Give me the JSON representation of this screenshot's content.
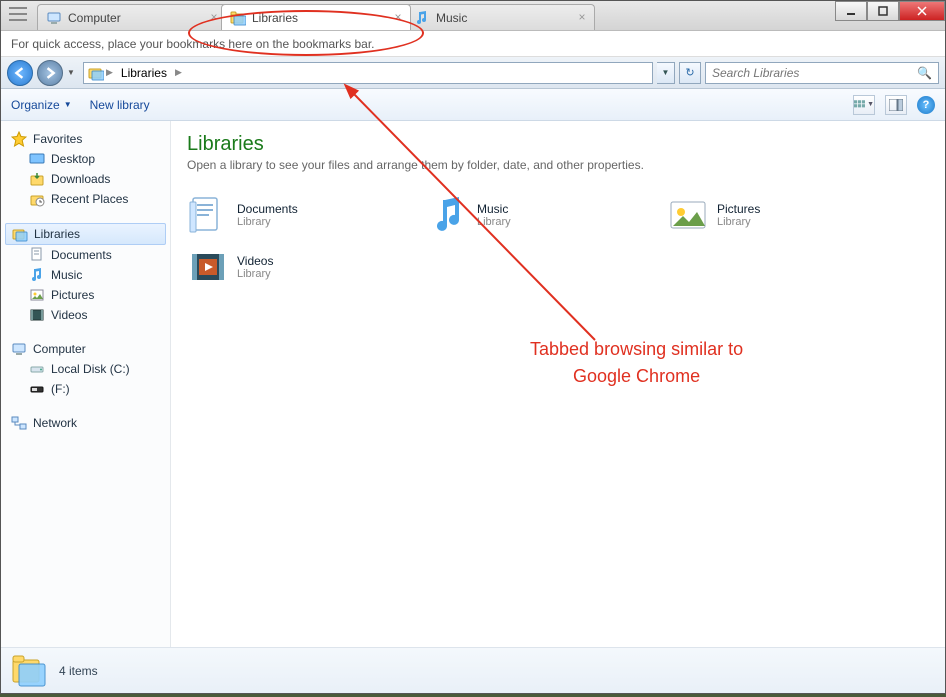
{
  "tabs": [
    {
      "label": "Computer",
      "active": false
    },
    {
      "label": "Libraries",
      "active": true
    },
    {
      "label": "Music",
      "active": false
    }
  ],
  "bookmarks_msg": "For quick access, place your bookmarks here on the bookmarks bar.",
  "breadcrumb": {
    "root_icon": "libraries",
    "items": [
      "Libraries"
    ]
  },
  "search": {
    "placeholder": "Search Libraries"
  },
  "toolbar": {
    "organize": "Organize",
    "newlib": "New library"
  },
  "sidebar": {
    "favorites": {
      "label": "Favorites",
      "children": [
        "Desktop",
        "Downloads",
        "Recent Places"
      ]
    },
    "libraries": {
      "label": "Libraries",
      "children": [
        "Documents",
        "Music",
        "Pictures",
        "Videos"
      ]
    },
    "computer": {
      "label": "Computer",
      "children": [
        "Local Disk (C:)",
        "(F:)"
      ]
    },
    "network": {
      "label": "Network"
    }
  },
  "content": {
    "title": "Libraries",
    "subtitle": "Open a library to see your files and arrange them by folder, date, and other properties.",
    "items": [
      {
        "name": "Documents",
        "type": "Library"
      },
      {
        "name": "Music",
        "type": "Library"
      },
      {
        "name": "Pictures",
        "type": "Library"
      },
      {
        "name": "Videos",
        "type": "Library"
      }
    ]
  },
  "status": {
    "count": "4 items"
  },
  "annotation": {
    "text1": "Tabbed browsing similar to",
    "text2": "Google Chrome"
  }
}
